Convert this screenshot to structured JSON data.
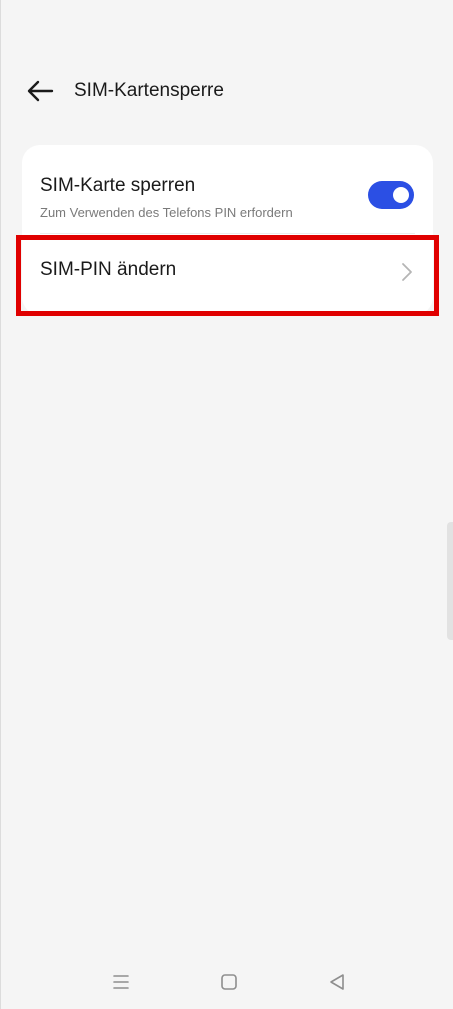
{
  "header": {
    "title": "SIM-Kartensperre",
    "back_icon": "arrow-left-icon"
  },
  "settings": {
    "lock_sim": {
      "title": "SIM-Karte sperren",
      "subtitle": "Zum Verwenden des Telefons PIN erfordern",
      "enabled": true
    },
    "change_pin": {
      "title": "SIM-PIN ändern",
      "icon": "chevron-right-icon"
    }
  },
  "navigation_bar": {
    "items": [
      "menu-icon",
      "home-icon",
      "back-icon"
    ]
  },
  "colors": {
    "accent": "#2b4fe4",
    "highlight": "#e00000",
    "background": "#f5f5f5",
    "card": "#ffffff"
  }
}
